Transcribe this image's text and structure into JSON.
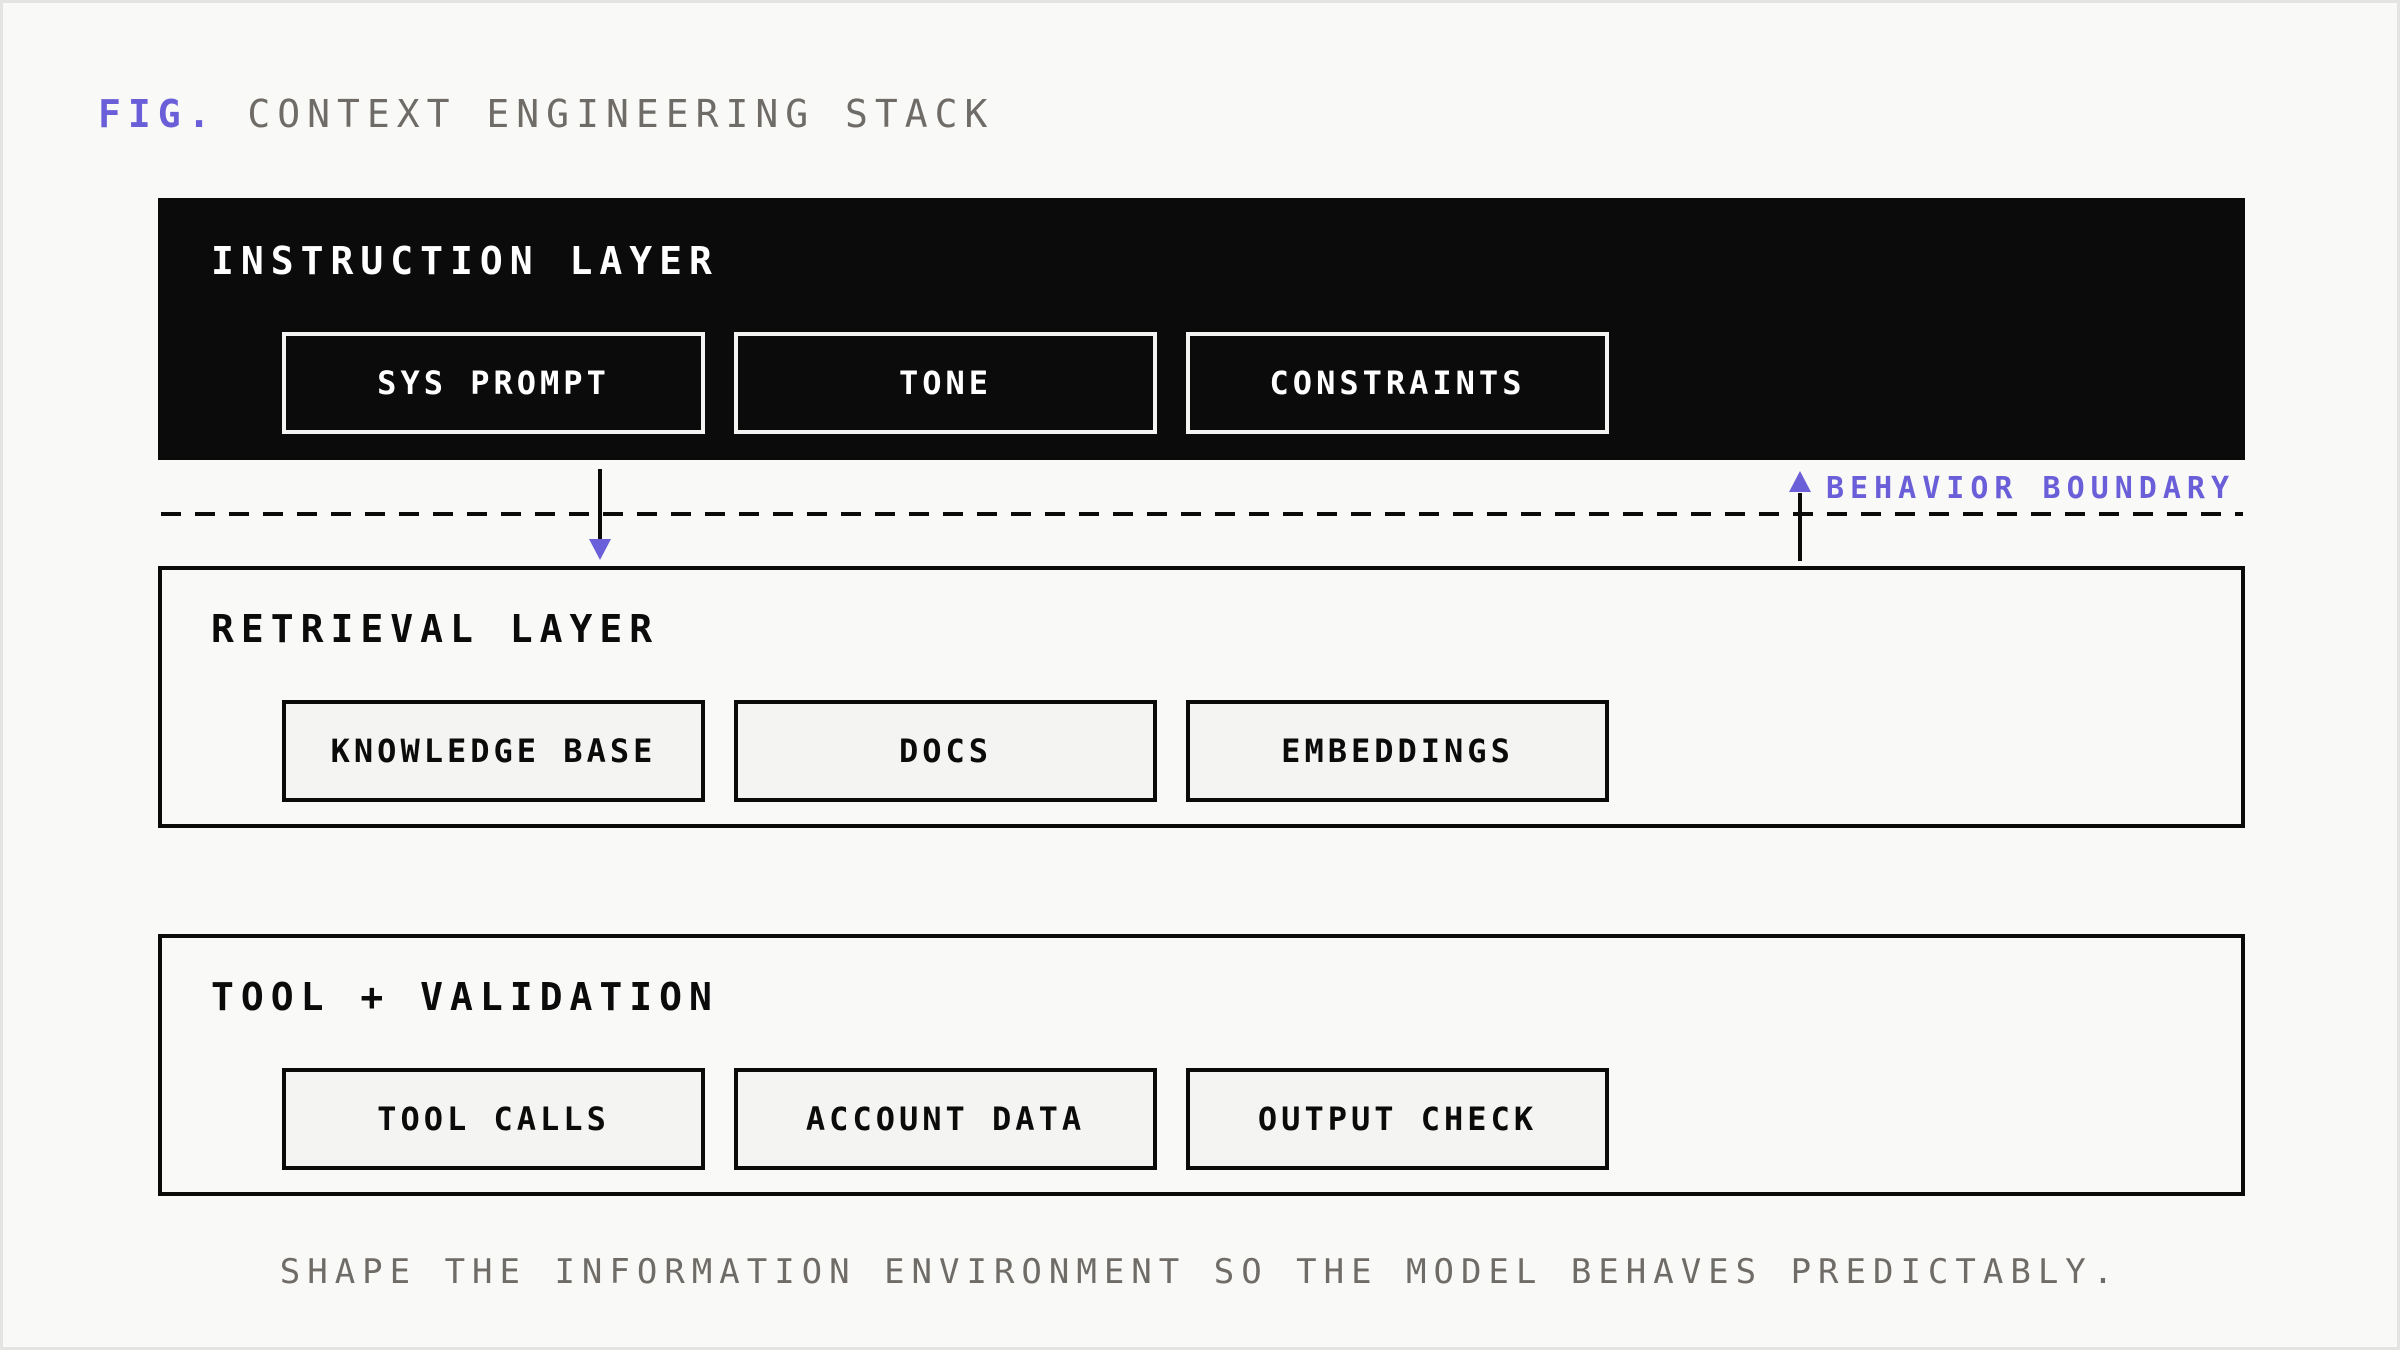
{
  "figure": {
    "prefix": "FIG.",
    "title": "CONTEXT ENGINEERING STACK"
  },
  "layers": [
    {
      "title": "INSTRUCTION LAYER",
      "style": "dark",
      "items": [
        "SYS PROMPT",
        "TONE",
        "CONSTRAINTS"
      ]
    },
    {
      "title": "RETRIEVAL LAYER",
      "style": "light",
      "items": [
        "KNOWLEDGE BASE",
        "DOCS",
        "EMBEDDINGS"
      ]
    },
    {
      "title": "TOOL + VALIDATION",
      "style": "light",
      "items": [
        "TOOL CALLS",
        "ACCOUNT DATA",
        "OUTPUT CHECK"
      ]
    }
  ],
  "boundary": {
    "label": "BEHAVIOR BOUNDARY"
  },
  "caption": "SHAPE THE INFORMATION ENVIRONMENT SO THE MODEL BEHAVES PREDICTABLY.",
  "colors": {
    "accent": "#6a5fd8",
    "ink": "#0b0b0b",
    "background": "#f9f9f7",
    "muted_text": "#6f6c68"
  }
}
